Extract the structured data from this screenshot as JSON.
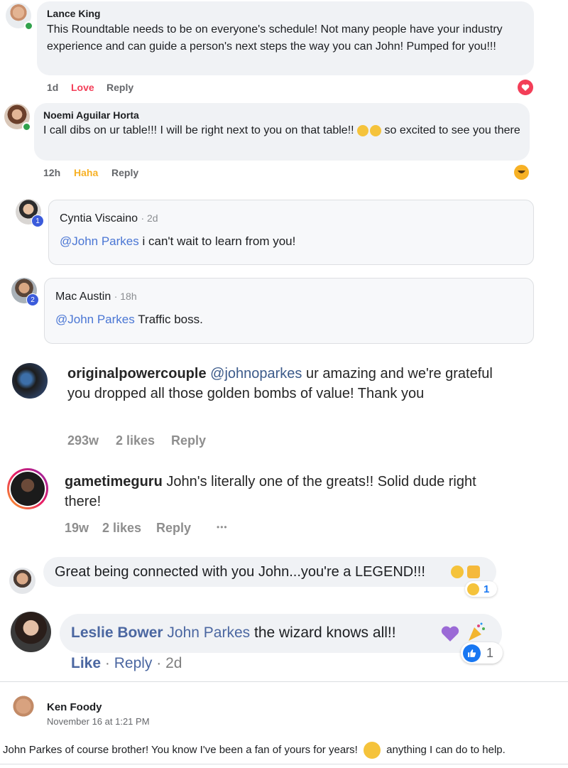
{
  "comments": [
    {
      "name": "Lance King",
      "text": "This Roundtable needs to be on everyone's schedule! Not many people have your industry experience and can guide a person's next steps the way you can John! Pumped for you!!!",
      "time": "1d",
      "reaction": "Love",
      "reply": "Reply"
    },
    {
      "name": "Noemi Aguilar Horta",
      "text_part1": "I call dibs on ur table!!! I will be right next to you on that table!!",
      "text_part2": "so excited to see you there",
      "time": "12h",
      "reaction": "Haha",
      "reply": "Reply"
    },
    {
      "name": "Cyntia Viscaino",
      "time": "· 2d",
      "mention": "@John Parkes",
      "text": "i can't wait to learn from you!",
      "badge": "1"
    },
    {
      "name": "Mac Austin",
      "time": "· 18h",
      "mention": "@John Parkes",
      "text": "Traffic boss.",
      "badge": "2"
    },
    {
      "name": "originalpowercouple",
      "mention": "@johnoparkes",
      "text": "ur amazing and we're grateful you dropped all those golden bombs of value! Thank you",
      "time": "293w",
      "likes": "2 likes",
      "reply": "Reply"
    },
    {
      "name": "gametimeguru",
      "text": "John's literally one of the greats!! Solid dude right there!",
      "time": "19w",
      "likes": "2 likes",
      "reply": "Reply",
      "more": "•••"
    },
    {
      "text": "Great being connected with you John...you're a LEGEND!!!",
      "reaction_count": "1"
    },
    {
      "name": "Leslie Bower",
      "mention": "John Parkes",
      "text": "the wizard knows all!!",
      "like": "Like",
      "reply": "Reply",
      "time": "2d",
      "sep": "·",
      "reaction_count": "1"
    }
  ],
  "post": {
    "name": "Ken Foody",
    "date": "November 16 at 1:21 PM",
    "text_part1": "John Parkes of course brother! You know I've been a fan of yours for years!",
    "text_part2": "anything I can do to help."
  },
  "colors": {
    "love": "#f33e58",
    "haha": "#f7b125",
    "mention": "#385898",
    "fb_blue": "#1877f2"
  }
}
